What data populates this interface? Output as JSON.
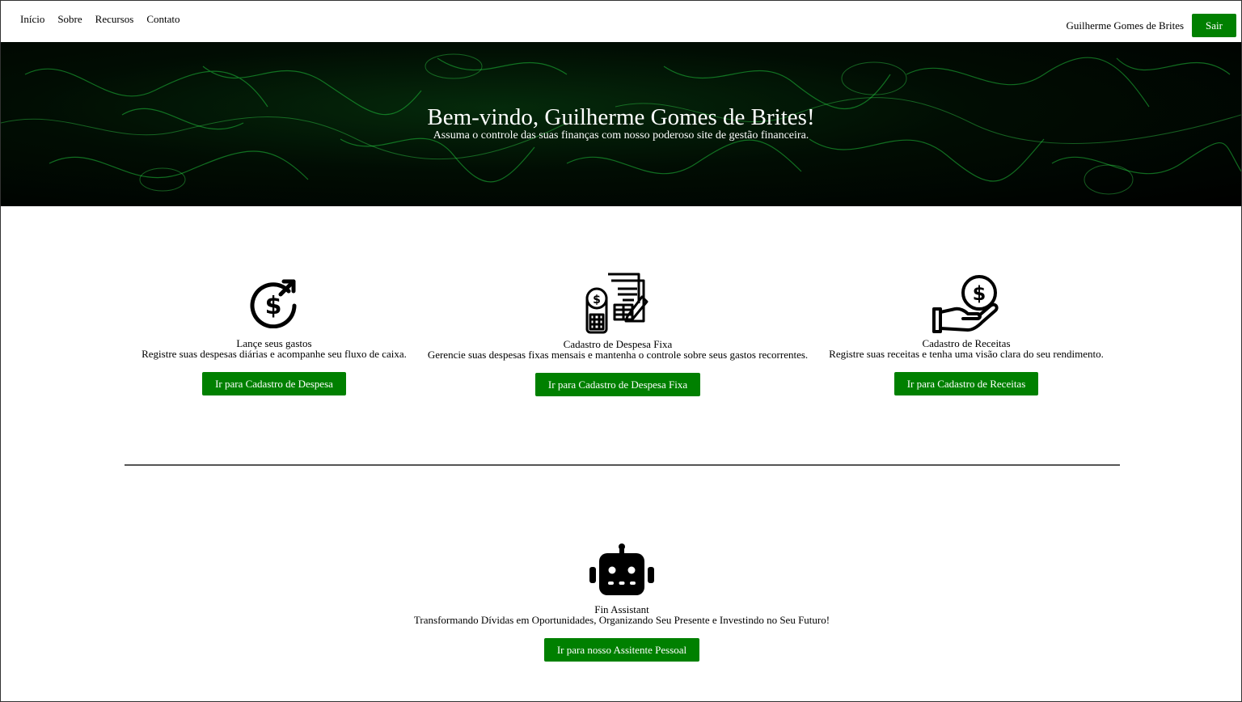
{
  "nav": {
    "links": [
      "Início",
      "Sobre",
      "Recursos",
      "Contato"
    ],
    "user_name": "Guilherme Gomes de Brites",
    "logout_label": "Sair"
  },
  "hero": {
    "title": "Bem-vindo, Guilherme Gomes de Brites!",
    "subtitle": "Assuma o controle das suas finanças com nosso poderoso site de gestão financeira."
  },
  "features": [
    {
      "title": "Lançe seus gastos",
      "description": "Registre suas despesas diárias e acompanhe seu fluxo de caixa.",
      "button": "Ir para Cadastro de Despesa",
      "icon": "dollar-circle-arrow-icon"
    },
    {
      "title": "Cadastro de Despesa Fixa",
      "description": "Gerencie suas despesas fixas mensais e mantenha o controle sobre seus gastos recorrentes.",
      "button": "Ir para Cadastro de Despesa Fixa",
      "icon": "document-calculator-icon"
    },
    {
      "title": "Cadastro de Receitas",
      "description": "Registre suas receitas e tenha uma visão clara do seu rendimento.",
      "button": "Ir para Cadastro de Receitas",
      "icon": "hand-coin-icon"
    }
  ],
  "assistant": {
    "title": "Fin Assistant",
    "description": "Transformando Dívidas em Oportunidades, Organizando Seu Presente e Investindo no Seu Futuro!",
    "button": "Ir para nosso Assitente Pessoal",
    "icon": "robot-icon"
  },
  "colors": {
    "accent": "#008000",
    "hero_bg": "#000000",
    "hero_glow": "#1aff3c"
  }
}
